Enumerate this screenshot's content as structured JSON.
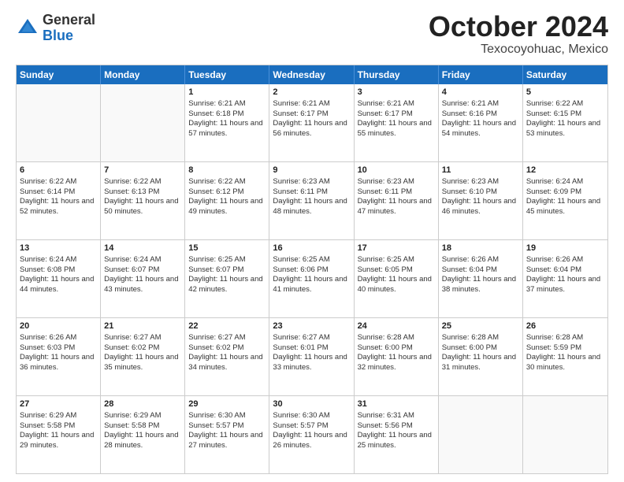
{
  "logo": {
    "general": "General",
    "blue": "Blue"
  },
  "title": {
    "month": "October 2024",
    "location": "Texocoyohuac, Mexico"
  },
  "days": [
    "Sunday",
    "Monday",
    "Tuesday",
    "Wednesday",
    "Thursday",
    "Friday",
    "Saturday"
  ],
  "weeks": [
    [
      {
        "day": "",
        "sunrise": "",
        "sunset": "",
        "daylight": ""
      },
      {
        "day": "",
        "sunrise": "",
        "sunset": "",
        "daylight": ""
      },
      {
        "day": "1",
        "sunrise": "Sunrise: 6:21 AM",
        "sunset": "Sunset: 6:18 PM",
        "daylight": "Daylight: 11 hours and 57 minutes."
      },
      {
        "day": "2",
        "sunrise": "Sunrise: 6:21 AM",
        "sunset": "Sunset: 6:17 PM",
        "daylight": "Daylight: 11 hours and 56 minutes."
      },
      {
        "day": "3",
        "sunrise": "Sunrise: 6:21 AM",
        "sunset": "Sunset: 6:17 PM",
        "daylight": "Daylight: 11 hours and 55 minutes."
      },
      {
        "day": "4",
        "sunrise": "Sunrise: 6:21 AM",
        "sunset": "Sunset: 6:16 PM",
        "daylight": "Daylight: 11 hours and 54 minutes."
      },
      {
        "day": "5",
        "sunrise": "Sunrise: 6:22 AM",
        "sunset": "Sunset: 6:15 PM",
        "daylight": "Daylight: 11 hours and 53 minutes."
      }
    ],
    [
      {
        "day": "6",
        "sunrise": "Sunrise: 6:22 AM",
        "sunset": "Sunset: 6:14 PM",
        "daylight": "Daylight: 11 hours and 52 minutes."
      },
      {
        "day": "7",
        "sunrise": "Sunrise: 6:22 AM",
        "sunset": "Sunset: 6:13 PM",
        "daylight": "Daylight: 11 hours and 50 minutes."
      },
      {
        "day": "8",
        "sunrise": "Sunrise: 6:22 AM",
        "sunset": "Sunset: 6:12 PM",
        "daylight": "Daylight: 11 hours and 49 minutes."
      },
      {
        "day": "9",
        "sunrise": "Sunrise: 6:23 AM",
        "sunset": "Sunset: 6:11 PM",
        "daylight": "Daylight: 11 hours and 48 minutes."
      },
      {
        "day": "10",
        "sunrise": "Sunrise: 6:23 AM",
        "sunset": "Sunset: 6:11 PM",
        "daylight": "Daylight: 11 hours and 47 minutes."
      },
      {
        "day": "11",
        "sunrise": "Sunrise: 6:23 AM",
        "sunset": "Sunset: 6:10 PM",
        "daylight": "Daylight: 11 hours and 46 minutes."
      },
      {
        "day": "12",
        "sunrise": "Sunrise: 6:24 AM",
        "sunset": "Sunset: 6:09 PM",
        "daylight": "Daylight: 11 hours and 45 minutes."
      }
    ],
    [
      {
        "day": "13",
        "sunrise": "Sunrise: 6:24 AM",
        "sunset": "Sunset: 6:08 PM",
        "daylight": "Daylight: 11 hours and 44 minutes."
      },
      {
        "day": "14",
        "sunrise": "Sunrise: 6:24 AM",
        "sunset": "Sunset: 6:07 PM",
        "daylight": "Daylight: 11 hours and 43 minutes."
      },
      {
        "day": "15",
        "sunrise": "Sunrise: 6:25 AM",
        "sunset": "Sunset: 6:07 PM",
        "daylight": "Daylight: 11 hours and 42 minutes."
      },
      {
        "day": "16",
        "sunrise": "Sunrise: 6:25 AM",
        "sunset": "Sunset: 6:06 PM",
        "daylight": "Daylight: 11 hours and 41 minutes."
      },
      {
        "day": "17",
        "sunrise": "Sunrise: 6:25 AM",
        "sunset": "Sunset: 6:05 PM",
        "daylight": "Daylight: 11 hours and 40 minutes."
      },
      {
        "day": "18",
        "sunrise": "Sunrise: 6:26 AM",
        "sunset": "Sunset: 6:04 PM",
        "daylight": "Daylight: 11 hours and 38 minutes."
      },
      {
        "day": "19",
        "sunrise": "Sunrise: 6:26 AM",
        "sunset": "Sunset: 6:04 PM",
        "daylight": "Daylight: 11 hours and 37 minutes."
      }
    ],
    [
      {
        "day": "20",
        "sunrise": "Sunrise: 6:26 AM",
        "sunset": "Sunset: 6:03 PM",
        "daylight": "Daylight: 11 hours and 36 minutes."
      },
      {
        "day": "21",
        "sunrise": "Sunrise: 6:27 AM",
        "sunset": "Sunset: 6:02 PM",
        "daylight": "Daylight: 11 hours and 35 minutes."
      },
      {
        "day": "22",
        "sunrise": "Sunrise: 6:27 AM",
        "sunset": "Sunset: 6:02 PM",
        "daylight": "Daylight: 11 hours and 34 minutes."
      },
      {
        "day": "23",
        "sunrise": "Sunrise: 6:27 AM",
        "sunset": "Sunset: 6:01 PM",
        "daylight": "Daylight: 11 hours and 33 minutes."
      },
      {
        "day": "24",
        "sunrise": "Sunrise: 6:28 AM",
        "sunset": "Sunset: 6:00 PM",
        "daylight": "Daylight: 11 hours and 32 minutes."
      },
      {
        "day": "25",
        "sunrise": "Sunrise: 6:28 AM",
        "sunset": "Sunset: 6:00 PM",
        "daylight": "Daylight: 11 hours and 31 minutes."
      },
      {
        "day": "26",
        "sunrise": "Sunrise: 6:28 AM",
        "sunset": "Sunset: 5:59 PM",
        "daylight": "Daylight: 11 hours and 30 minutes."
      }
    ],
    [
      {
        "day": "27",
        "sunrise": "Sunrise: 6:29 AM",
        "sunset": "Sunset: 5:58 PM",
        "daylight": "Daylight: 11 hours and 29 minutes."
      },
      {
        "day": "28",
        "sunrise": "Sunrise: 6:29 AM",
        "sunset": "Sunset: 5:58 PM",
        "daylight": "Daylight: 11 hours and 28 minutes."
      },
      {
        "day": "29",
        "sunrise": "Sunrise: 6:30 AM",
        "sunset": "Sunset: 5:57 PM",
        "daylight": "Daylight: 11 hours and 27 minutes."
      },
      {
        "day": "30",
        "sunrise": "Sunrise: 6:30 AM",
        "sunset": "Sunset: 5:57 PM",
        "daylight": "Daylight: 11 hours and 26 minutes."
      },
      {
        "day": "31",
        "sunrise": "Sunrise: 6:31 AM",
        "sunset": "Sunset: 5:56 PM",
        "daylight": "Daylight: 11 hours and 25 minutes."
      },
      {
        "day": "",
        "sunrise": "",
        "sunset": "",
        "daylight": ""
      },
      {
        "day": "",
        "sunrise": "",
        "sunset": "",
        "daylight": ""
      }
    ]
  ]
}
